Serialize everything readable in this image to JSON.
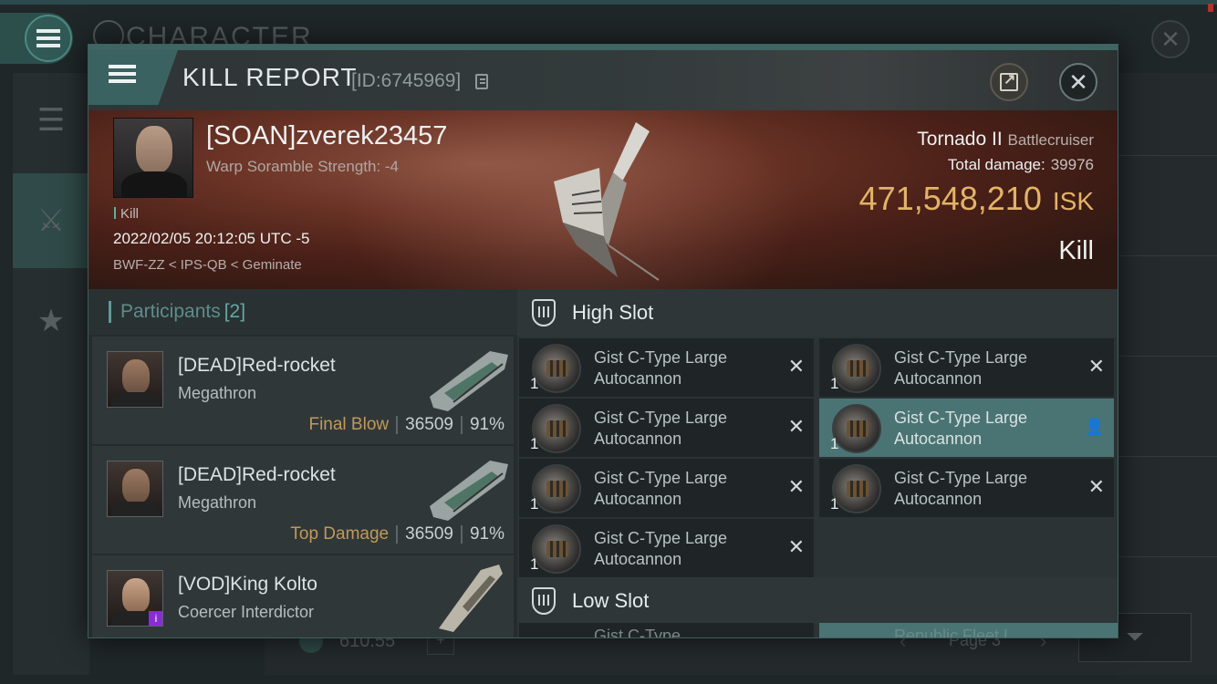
{
  "background": {
    "window_title": "CHARACTER",
    "amount": "610.55",
    "page": "Page 3"
  },
  "header": {
    "title": "KILL REPORT",
    "id_label": "[ID:6745969]"
  },
  "victim": {
    "name": "[SOAN]zverek23457",
    "scramble": "Warp Soramble Strength: -4",
    "kill_tag": "Kill",
    "datetime": "2022/02/05 20:12:05 UTC -5",
    "location": "BWF-ZZ < IPS-QB < Geminate",
    "ship_name": "Tornado II",
    "ship_class": "Battlecruiser",
    "total_damage_label": "Total damage:",
    "total_damage_value": "39976",
    "isk_value": "471,548,210",
    "isk_unit": "ISK",
    "result": "Kill"
  },
  "participants": {
    "label": "Participants",
    "count": "[2]",
    "items": [
      {
        "name": "[DEAD]Red-rocket",
        "ship": "Megathron",
        "tag": "Final Blow",
        "damage": "36509",
        "percent": "91%"
      },
      {
        "name": "[DEAD]Red-rocket",
        "ship": "Megathron",
        "tag": "Top Damage",
        "damage": "36509",
        "percent": "91%"
      },
      {
        "name": "[VOD]King Kolto",
        "ship": "Coercer Interdictor",
        "badge": "i"
      }
    ]
  },
  "fitting": {
    "high_slot_label": "High Slot",
    "low_slot_label": "Low Slot",
    "modules": [
      {
        "name": "Gist C-Type Large Autocannon",
        "qty": "1",
        "status": "destroyed"
      },
      {
        "name": "Gist C-Type Large Autocannon",
        "qty": "1",
        "status": "destroyed"
      },
      {
        "name": "Gist C-Type Large Autocannon",
        "qty": "1",
        "status": "destroyed"
      },
      {
        "name": "Gist C-Type Large Autocannon",
        "qty": "1",
        "status": "dropped"
      },
      {
        "name": "Gist C-Type Large Autocannon",
        "qty": "1",
        "status": "destroyed"
      },
      {
        "name": "Gist C-Type Large Autocannon",
        "qty": "1",
        "status": "destroyed"
      },
      {
        "name": "Gist C-Type Large Autocannon",
        "qty": "1",
        "status": "destroyed"
      }
    ],
    "low_partial_1": "Gist C-Type",
    "low_partial_2": "Republic Fleet L"
  },
  "colors": {
    "accent_teal": "#4a7473",
    "isk_gold": "#e3b464",
    "tag_gold": "#c09a58"
  }
}
